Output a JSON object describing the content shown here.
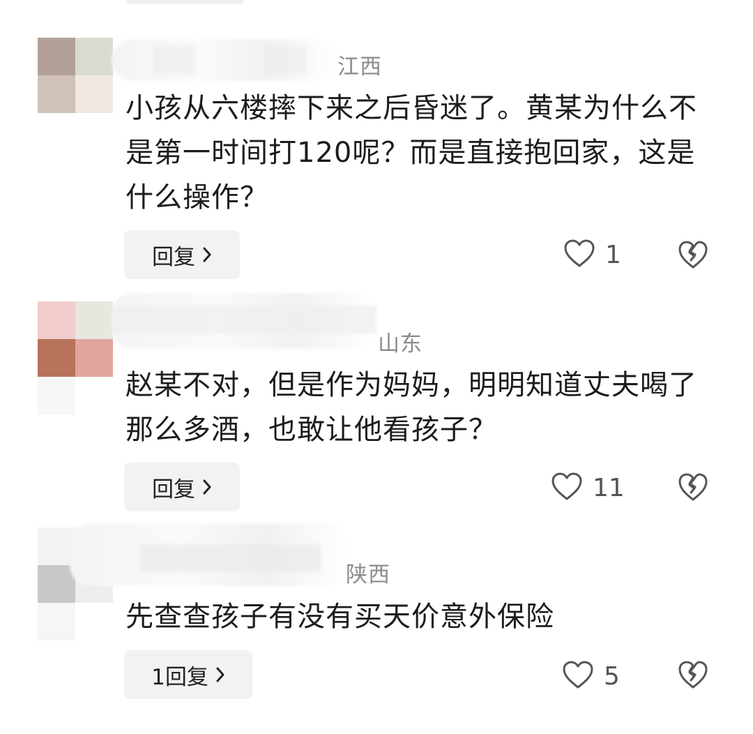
{
  "comments": [
    {
      "region": "江西",
      "text": "小孩从六楼摔下来之后昏迷了。黄某为什么不是第一时间打120呢？而是直接抱回家，这是什么操作？",
      "reply_label": "回复",
      "like_count": "1",
      "avatar_colors": [
        "#b3a199",
        "#dcdbd2",
        "#cfc2b7",
        "#f0e9e2"
      ]
    },
    {
      "region": "山东",
      "text": "赵某不对，但是作为妈妈，明明知道丈夫喝了那么多酒，也敢让他看孩子？",
      "reply_label": "回复",
      "like_count": "11",
      "avatar_colors": [
        "#f0cccc",
        "#e7e6df",
        "#b67359",
        "#e2a59e"
      ]
    },
    {
      "region": "陕西",
      "text": "先查查孩子有没有买天价意外保险",
      "reply_label": "1回复",
      "like_count": "5",
      "avatar_colors": [
        "#f3f3f3",
        "#fafafa",
        "#c8c8c8",
        "#ededed"
      ]
    }
  ],
  "icons": {
    "chevron": "chevron-right-icon",
    "like": "heart-outline-icon",
    "dislike": "broken-heart-icon"
  }
}
